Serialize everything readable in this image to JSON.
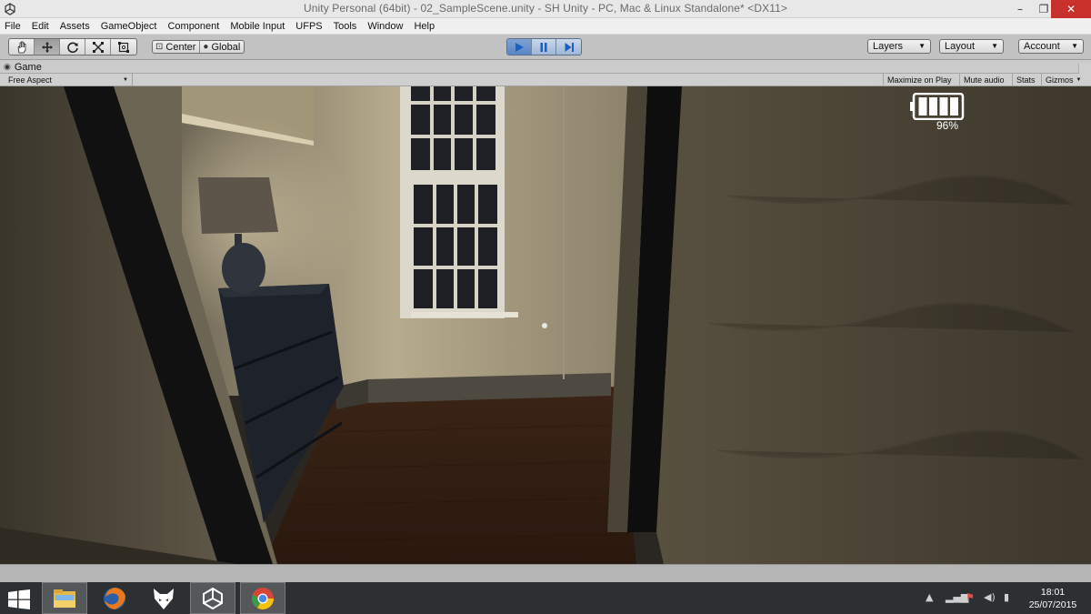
{
  "window": {
    "title": "Unity Personal (64bit) - 02_SampleScene.unity - SH Unity - PC, Mac & Linux Standalone* <DX11>",
    "controls": {
      "minimize": "–",
      "maximize": "❐",
      "close": "✕"
    }
  },
  "menu": [
    "File",
    "Edit",
    "Assets",
    "GameObject",
    "Component",
    "Mobile Input",
    "UFPS",
    "Tools",
    "Window",
    "Help"
  ],
  "toolbar": {
    "transform_tools": [
      "hand-icon",
      "move-icon",
      "rotate-icon",
      "scale-icon",
      "rect-icon"
    ],
    "pivot_mode": "Center",
    "pivot_rotation": "Global",
    "play_controls": [
      "play-icon",
      "pause-icon",
      "step-icon"
    ],
    "layers_label": "Layers",
    "layout_label": "Layout",
    "account_label": "Account"
  },
  "game_view": {
    "tab_label": "Game",
    "aspect_label": "Free Aspect",
    "maximize_on_play": "Maximize on Play",
    "mute_audio": "Mute audio",
    "stats": "Stats",
    "gizmos": "Gizmos",
    "battery_percent_text": "96%",
    "battery_level": 0.96
  },
  "taskbar": {
    "apps": [
      "file-explorer-icon",
      "firefox-icon",
      "foobar-icon",
      "unity-icon",
      "chrome-icon"
    ],
    "active_app": "unity-icon",
    "time": "18:01",
    "date": "25/07/2015"
  },
  "colors": {
    "play_active": "#5a86c4",
    "close_button": "#c9302c",
    "taskbar": "#2c3033"
  }
}
